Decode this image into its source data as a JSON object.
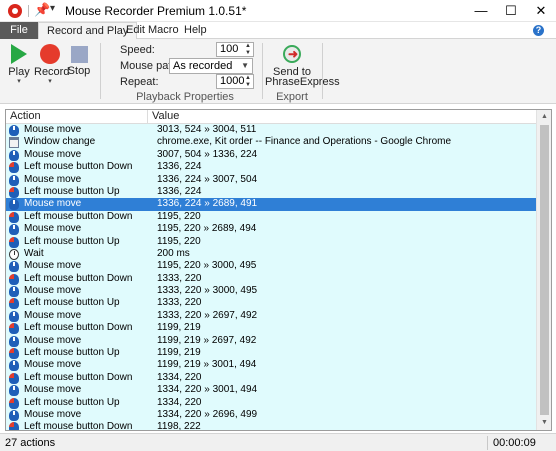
{
  "window": {
    "title": "Mouse Recorder Premium 1.0.51*",
    "minimize": "—",
    "maximize": "☐",
    "close": "✕"
  },
  "menu": {
    "tabs": [
      "File",
      "Record and Play",
      "Edit Macro",
      "Help"
    ],
    "help_glyph": "?"
  },
  "ribbon": {
    "play": "Play",
    "record": "Record",
    "stop": "Stop",
    "speed_label": "Speed:",
    "speed_value": "100",
    "mouse_path_label": "Mouse path:",
    "mouse_path_value": "As recorded",
    "repeat_label": "Repeat:",
    "repeat_value": "1000",
    "playback_group": "Playback Properties",
    "send_label_1": "Send to",
    "send_label_2": "PhraseExpress",
    "export_group": "Export"
  },
  "list": {
    "columns": [
      "Action",
      "Value"
    ],
    "rows": [
      {
        "icon": "mouse",
        "action": "Mouse move",
        "value": "3013, 524 » 3004, 511"
      },
      {
        "icon": "window",
        "action": "Window change",
        "value": "chrome.exe, Kit order -- Finance and Operations - Google Chrome"
      },
      {
        "icon": "mouse",
        "action": "Mouse move",
        "value": "3007, 504 » 1336, 224"
      },
      {
        "icon": "left",
        "action": "Left mouse button Down",
        "value": "1336, 224"
      },
      {
        "icon": "mouse",
        "action": "Mouse move",
        "value": "1336, 224 » 3007, 504"
      },
      {
        "icon": "left",
        "action": "Left mouse button Up",
        "value": "1336, 224"
      },
      {
        "icon": "mouse",
        "action": "Mouse move",
        "value": "1336, 224 » 2689, 491",
        "selected": true
      },
      {
        "icon": "left",
        "action": "Left mouse button Down",
        "value": "1195, 220"
      },
      {
        "icon": "mouse",
        "action": "Mouse move",
        "value": "1195, 220 » 2689, 494"
      },
      {
        "icon": "left",
        "action": "Left mouse button Up",
        "value": "1195, 220"
      },
      {
        "icon": "wait",
        "action": "Wait",
        "value": "200 ms"
      },
      {
        "icon": "mouse",
        "action": "Mouse move",
        "value": "1195, 220 » 3000, 495"
      },
      {
        "icon": "left",
        "action": "Left mouse button Down",
        "value": "1333, 220"
      },
      {
        "icon": "mouse",
        "action": "Mouse move",
        "value": "1333, 220 » 3000, 495"
      },
      {
        "icon": "left",
        "action": "Left mouse button Up",
        "value": "1333, 220"
      },
      {
        "icon": "mouse",
        "action": "Mouse move",
        "value": "1333, 220 » 2697, 492"
      },
      {
        "icon": "left",
        "action": "Left mouse button Down",
        "value": "1199, 219"
      },
      {
        "icon": "mouse",
        "action": "Mouse move",
        "value": "1199, 219 » 2697, 492"
      },
      {
        "icon": "left",
        "action": "Left mouse button Up",
        "value": "1199, 219"
      },
      {
        "icon": "mouse",
        "action": "Mouse move",
        "value": "1199, 219 » 3001, 494"
      },
      {
        "icon": "left",
        "action": "Left mouse button Down",
        "value": "1334, 220"
      },
      {
        "icon": "mouse",
        "action": "Mouse move",
        "value": "1334, 220 » 3001, 494"
      },
      {
        "icon": "left",
        "action": "Left mouse button Up",
        "value": "1334, 220"
      },
      {
        "icon": "mouse",
        "action": "Mouse move",
        "value": "1334, 220 » 2696, 499"
      },
      {
        "icon": "left",
        "action": "Left mouse button Down",
        "value": "1198, 222"
      }
    ]
  },
  "status": {
    "count": "27 actions",
    "time": "00:00:09"
  },
  "colors": {
    "row_bg": "#e0fbfd",
    "selected_bg": "#2f7fd6",
    "play": "#27a844",
    "record": "#e53b2c",
    "stop": "#9aa7c6"
  }
}
